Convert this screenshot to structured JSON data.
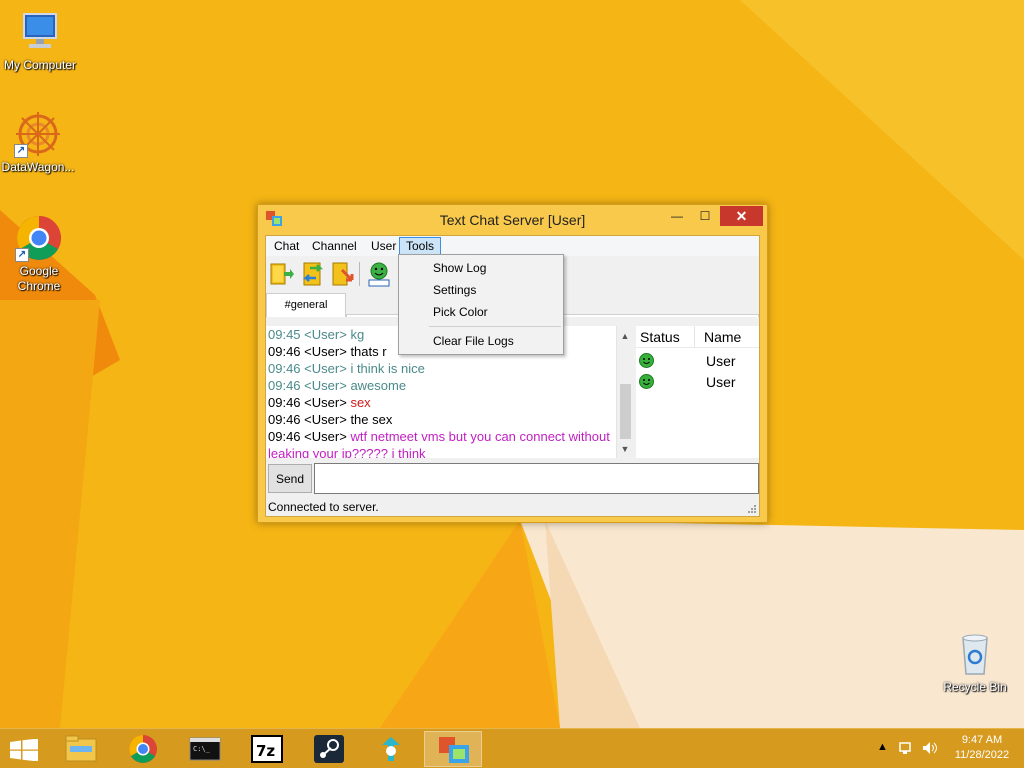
{
  "desktop": {
    "icons": [
      {
        "label": "My Computer",
        "icon": "computer-icon"
      },
      {
        "label": "DataWagon...",
        "icon": "datawagon-icon"
      },
      {
        "label": "Google Chrome",
        "icon": "chrome-icon"
      },
      {
        "label": "Recycle Bin",
        "icon": "recycle-bin-icon"
      }
    ]
  },
  "window": {
    "title": "Text Chat Server [User]",
    "controls": {
      "minimize": "—",
      "maximize": "☐",
      "close": "✕"
    },
    "menu": [
      "Chat",
      "Channel",
      "User",
      "Tools"
    ],
    "active_menu": "Tools",
    "toolbar": [
      "join-channel-icon",
      "channel-transfer-icon",
      "leave-channel-icon",
      "user-whois-icon"
    ],
    "tabs": [
      "#general"
    ],
    "chat_lines": [
      {
        "time": "09:45",
        "nick": "<User>",
        "text": "kg",
        "color": "#4a8a8a"
      },
      {
        "time": "09:46",
        "nick": "<User>",
        "text": "thats r",
        "color": "#000000"
      },
      {
        "time": "09:46",
        "nick": "<User>",
        "text": "i think is nice",
        "color": "#4a8a8a"
      },
      {
        "time": "09:46",
        "nick": "<User>",
        "text": "awesome",
        "color": "#4a8a8a"
      },
      {
        "time": "09:46",
        "nick": "<User>",
        "text": "sex",
        "color": "#d11a1a"
      },
      {
        "time": "09:46",
        "nick": "<User>",
        "text": "the sex",
        "color": "#000000"
      },
      {
        "time": "09:46",
        "nick": "<User>",
        "text": "wtf netmeet vms but you can connect without leaking your ip????? i think",
        "color": "#c21fc2"
      }
    ],
    "userlist": {
      "columns": [
        "Status",
        "Name"
      ],
      "rows": [
        {
          "status": "online",
          "name": "User"
        },
        {
          "status": "online",
          "name": "User"
        }
      ]
    },
    "send_label": "Send",
    "message_value": "",
    "status_text": "Connected to server.",
    "tools_menu": [
      "Show Log",
      "Settings",
      "Pick Color",
      "Clear File Logs"
    ]
  },
  "taskbar": {
    "apps": [
      "file-explorer-icon",
      "chrome-icon",
      "command-prompt-icon",
      "7zip-icon",
      "steam-icon",
      "app-icon",
      "text-chat-icon"
    ],
    "time": "9:47 AM",
    "date": "11/28/2022"
  },
  "colors": {
    "wallpaper": "#f5b514",
    "titlebar": "#f8c94a",
    "close_button": "#c7372c"
  }
}
